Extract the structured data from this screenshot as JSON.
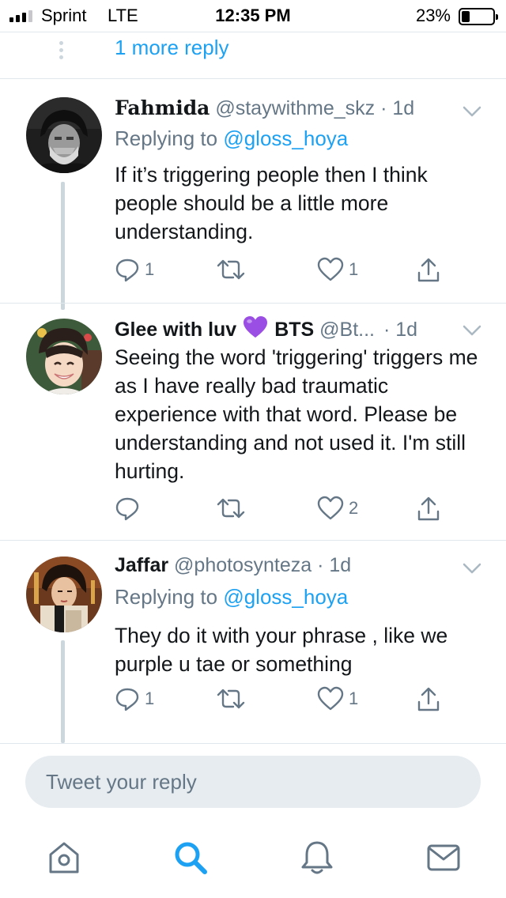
{
  "status_bar": {
    "carrier": "Sprint",
    "network": "LTE",
    "time": "12:35 PM",
    "battery_percent": "23%",
    "battery_level": 0.23,
    "signal_bars": 3
  },
  "thread": {
    "more_replies_label": "1 more reply"
  },
  "tweets": [
    {
      "name": "Fahmida",
      "handle": "@staywithme_skz",
      "time": "· 1d",
      "replying_prefix": "Replying to",
      "replying_to": "@gloss_hoya",
      "text": "If it’s triggering people then I think people should be a little more understanding.",
      "replies": "1",
      "retweets": "",
      "likes": "1"
    },
    {
      "name_part1": "Glee with luv",
      "emoji": "purple-heart",
      "name_part2": "BTS",
      "handle": "@Bt...",
      "time": "· 1d",
      "text": "Seeing the word 'triggering' triggers me as I have really bad traumatic experience with that word. Please be understanding and not used it. I'm still hurting.",
      "replies": "",
      "retweets": "",
      "likes": "2"
    },
    {
      "name": "Jaffar",
      "handle": "@photosynteza",
      "time": "· 1d",
      "replying_prefix": "Replying to",
      "replying_to": "@gloss_hoya",
      "text": "They do it with your phrase , like we purple u tae or something",
      "replies": "1",
      "retweets": "",
      "likes": "1"
    }
  ],
  "reply_box": {
    "placeholder": "Tweet your reply"
  },
  "nav": {
    "active": "search",
    "items": [
      "home-icon",
      "search-icon",
      "bell-icon",
      "mail-icon"
    ]
  },
  "colors": {
    "accent": "#1da1f2",
    "secondary_text": "#657786",
    "thread_line": "#ccd6dd",
    "divider": "#e1e8ed",
    "input_bg": "#e6ecf0",
    "emoji_purple": "#9b4ee3"
  }
}
